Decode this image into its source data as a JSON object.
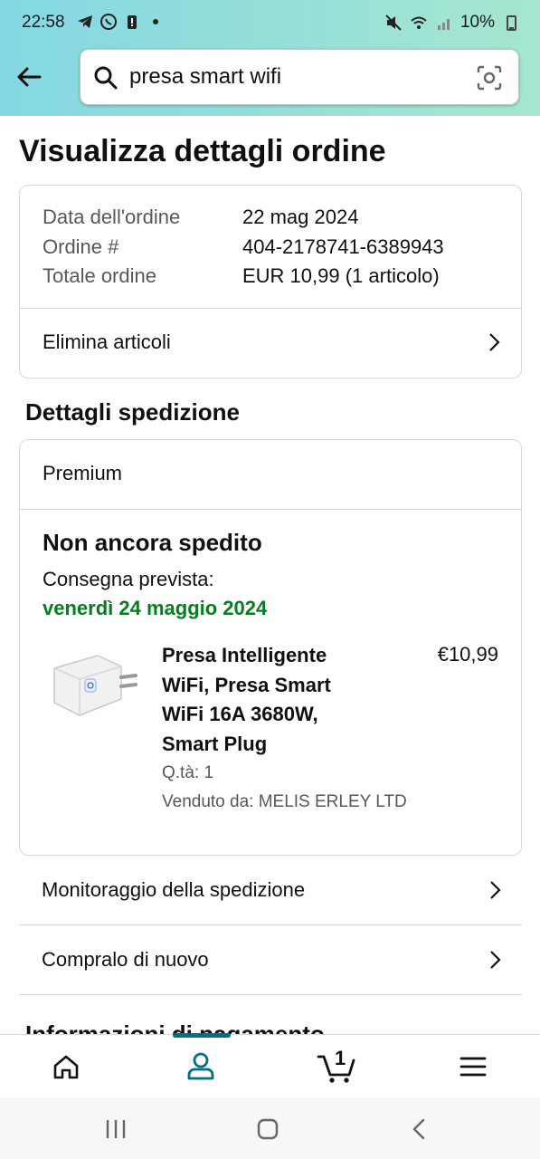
{
  "status_bar": {
    "time": "22:58",
    "battery": "10%"
  },
  "search": {
    "query": "presa smart wifi"
  },
  "page_title": "Visualizza dettagli ordine",
  "order_summary": {
    "rows": [
      {
        "label": "Data dell'ordine",
        "value": "22 mag 2024"
      },
      {
        "label": "Ordine #",
        "value": "404-2178741-6389943"
      },
      {
        "label": "Totale ordine",
        "value": "EUR 10,99 (1 articolo)"
      }
    ],
    "delete_items_label": "Elimina articoli"
  },
  "shipping": {
    "section_title": "Dettagli spedizione",
    "shipping_type": "Premium",
    "status": "Non ancora spedito",
    "expected_label": "Consegna prevista:",
    "expected_date": "venerdì 24 maggio 2024",
    "item": {
      "title": "Presa Intelligente WiFi, Presa Smart WiFi 16A 3680W, Smart Plug",
      "price": "€10,99",
      "qty": "Q.tà: 1",
      "seller": "Venduto da: MELIS ERLEY LTD"
    }
  },
  "actions": {
    "track": "Monitoraggio della spedizione",
    "buy_again": "Compralo di nuovo"
  },
  "next_section_title": "Informazioni di pagamento",
  "bottom_nav": {
    "cart_count": "1",
    "active": "account"
  },
  "colors": {
    "accent": "#007185",
    "green": "#067d1e",
    "header_gradient_start": "#84d8e3",
    "header_gradient_end": "#a6e6cf"
  }
}
